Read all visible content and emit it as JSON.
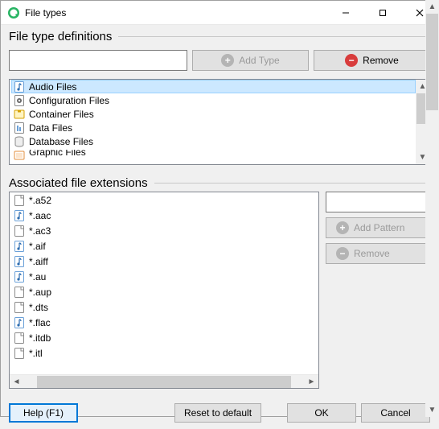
{
  "title": "File types",
  "section1": "File type definitions",
  "section2": "Associated file extensions",
  "filter_value": "",
  "btn_add_type": "Add Type",
  "btn_remove": "Remove",
  "types": [
    {
      "label": "Audio Files",
      "icon": "audio",
      "selected": true
    },
    {
      "label": "Configuration Files",
      "icon": "config",
      "selected": false
    },
    {
      "label": "Container Files",
      "icon": "container",
      "selected": false
    },
    {
      "label": "Data Files",
      "icon": "data",
      "selected": false
    },
    {
      "label": "Database Files",
      "icon": "database",
      "selected": false
    },
    {
      "label": "Graphic Files",
      "icon": "graphic",
      "selected": false
    }
  ],
  "pattern_input": "",
  "btn_add_pattern": "Add Pattern",
  "btn_remove_pattern": "Remove",
  "extensions": [
    {
      "label": "*.a52",
      "icon": "page"
    },
    {
      "label": "*.aac",
      "icon": "audio"
    },
    {
      "label": "*.ac3",
      "icon": "page"
    },
    {
      "label": "*.aif",
      "icon": "audio"
    },
    {
      "label": "*.aiff",
      "icon": "audio"
    },
    {
      "label": "*.au",
      "icon": "audio"
    },
    {
      "label": "*.aup",
      "icon": "page"
    },
    {
      "label": "*.dts",
      "icon": "page"
    },
    {
      "label": "*.flac",
      "icon": "audio"
    },
    {
      "label": "*.itdb",
      "icon": "page"
    },
    {
      "label": "*.itl",
      "icon": "page"
    }
  ],
  "footer": {
    "help": "Help (F1)",
    "reset": "Reset to default",
    "ok": "OK",
    "cancel": "Cancel"
  }
}
